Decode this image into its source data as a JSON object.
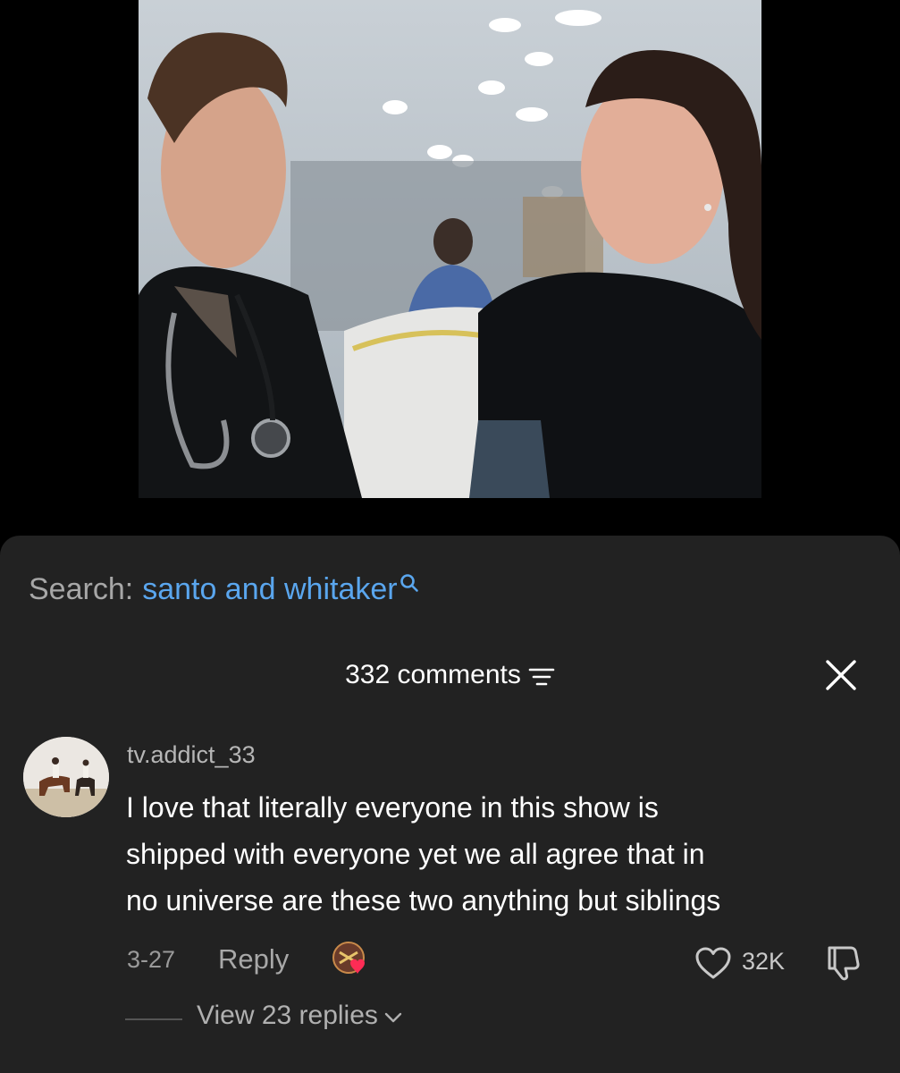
{
  "search": {
    "prefix": "Search:",
    "term": "santo and whitaker",
    "icon": "search-icon"
  },
  "comments_header": {
    "count_label": "332 comments",
    "sort_icon": "sort-icon",
    "close_icon": "close-icon"
  },
  "comment": {
    "username": "tv.addict_33",
    "text_lines": [
      "I love that literally everyone in this show is",
      "shipped with everyone yet we all agree that in",
      "no universe are these two anything but siblings"
    ],
    "date": "3-27",
    "reply_label": "Reply",
    "like_count": "32K",
    "view_replies_label": "View 23 replies"
  },
  "colors": {
    "background": "#000000",
    "sheet": "#222222",
    "link_blue": "#5aa6ee",
    "heart_red": "#fe2c55"
  }
}
